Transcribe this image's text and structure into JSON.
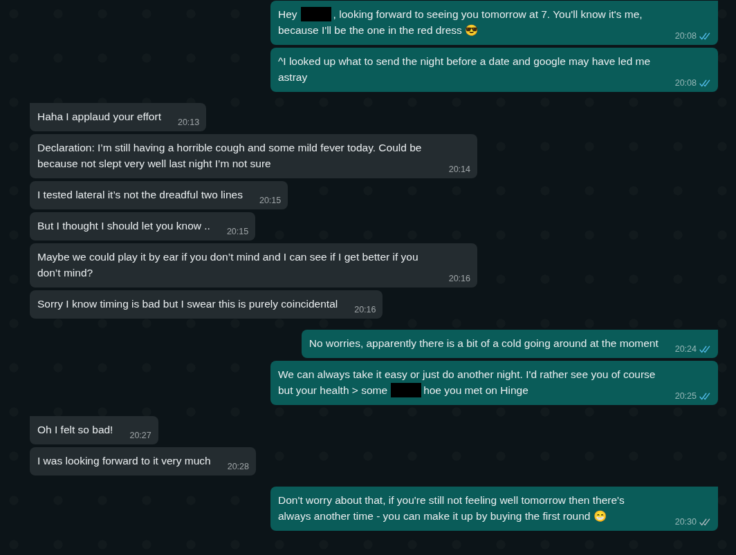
{
  "messages": [
    {
      "outgoing": true,
      "tail": true,
      "parts": [
        {
          "kind": "text",
          "text": "Hey"
        },
        {
          "kind": "redacted"
        },
        {
          "kind": "text",
          "text": ", looking forward to seeing you tomorrow at 7. You'll know it's me, because I'll be the one in the red dress 😎"
        }
      ],
      "time": "20:08",
      "read": true
    },
    {
      "outgoing": true,
      "tail": false,
      "parts": [
        {
          "kind": "text",
          "text": "^I looked up what to send the night before a date and google may have led me astray"
        }
      ],
      "time": "20:08",
      "read": true
    },
    {
      "outgoing": false,
      "tail": true,
      "parts": [
        {
          "kind": "text",
          "text": "Haha I applaud your effort"
        }
      ],
      "time": "20:13"
    },
    {
      "outgoing": false,
      "tail": false,
      "parts": [
        {
          "kind": "text",
          "text": "Declaration: I’m still having a horrible cough and some mild fever today. Could be because not slept very well last night I’m not sure"
        }
      ],
      "time": "20:14"
    },
    {
      "outgoing": false,
      "tail": false,
      "parts": [
        {
          "kind": "text",
          "text": "I tested lateral it’s not the dreadful two lines"
        }
      ],
      "time": "20:15"
    },
    {
      "outgoing": false,
      "tail": false,
      "parts": [
        {
          "kind": "text",
          "text": "But I thought I should let you know .."
        }
      ],
      "time": "20:15"
    },
    {
      "outgoing": false,
      "tail": false,
      "parts": [
        {
          "kind": "text",
          "text": "Maybe we could play it by ear if you don’t mind and I can see if I get better if you don’t mind?"
        }
      ],
      "time": "20:16"
    },
    {
      "outgoing": false,
      "tail": false,
      "parts": [
        {
          "kind": "text",
          "text": "Sorry I know timing is bad but I swear this is purely coincidental"
        }
      ],
      "time": "20:16"
    },
    {
      "outgoing": true,
      "tail": true,
      "parts": [
        {
          "kind": "text",
          "text": "No worries, apparently there is a bit of a cold going around at the moment"
        }
      ],
      "time": "20:24",
      "read": true
    },
    {
      "outgoing": true,
      "tail": false,
      "parts": [
        {
          "kind": "text",
          "text": "We can always take it easy or just do another night. I'd rather see you of course but your health > some"
        },
        {
          "kind": "redacted"
        },
        {
          "kind": "text",
          "text": "hoe you met on Hinge"
        }
      ],
      "time": "20:25",
      "read": true
    },
    {
      "outgoing": false,
      "tail": true,
      "parts": [
        {
          "kind": "text",
          "text": "Oh I felt so bad!"
        }
      ],
      "time": "20:27"
    },
    {
      "outgoing": false,
      "tail": false,
      "parts": [
        {
          "kind": "text",
          "text": "I was looking forward to it very much"
        }
      ],
      "time": "20:28"
    },
    {
      "outgoing": true,
      "tail": true,
      "parts": [
        {
          "kind": "text",
          "text": "Don't worry about that, if you're still not feeling well tomorrow then there's always another time - you can make it up by buying the first round 😁"
        }
      ],
      "time": "20:30",
      "read": false
    }
  ]
}
